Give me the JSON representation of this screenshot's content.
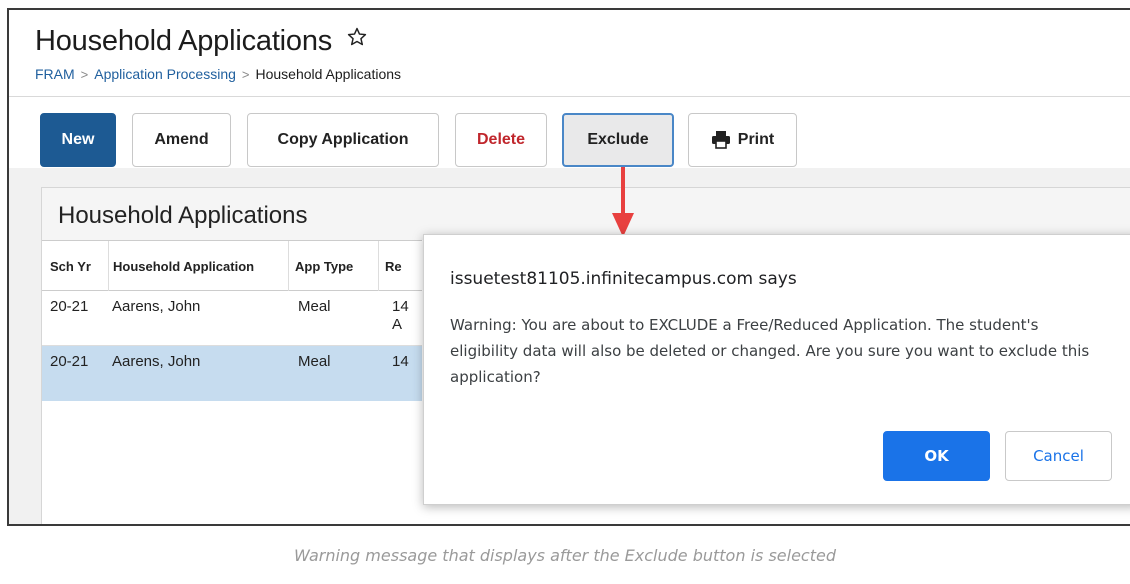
{
  "header": {
    "title": "Household Applications",
    "star_icon": "star-outline-icon",
    "breadcrumb": [
      "FRAM",
      "Application Processing",
      "Household Applications"
    ],
    "breadcrumb_separator": ">"
  },
  "toolbar": {
    "new_label": "New",
    "amend_label": "Amend",
    "copy_label": "Copy Application",
    "delete_label": "Delete",
    "exclude_label": "Exclude",
    "print_label": "Print",
    "print_icon": "printer-icon"
  },
  "panel": {
    "title": "Household Applications",
    "columns": [
      "Sch Yr",
      "Household Application",
      "App Type",
      "Re"
    ],
    "rows": [
      {
        "sch_yr": "20-21",
        "household": "Aarens, John",
        "app_type": "Meal",
        "received": "14\nA"
      },
      {
        "sch_yr": "20-21",
        "household": "Aarens, John",
        "app_type": "Meal",
        "received": "14"
      }
    ]
  },
  "dialog": {
    "title": "issuetest81105.infinitecampus.com says",
    "message": "Warning: You are about to EXCLUDE a Free/Reduced Application. The student's eligibility data will also be deleted or changed. Are you sure you want to exclude this application?",
    "ok_label": "OK",
    "cancel_label": "Cancel"
  },
  "caption": "Warning message that displays after the Exclude button is selected",
  "colors": {
    "primary_button": "#1d5a93",
    "delete_text": "#c0262c",
    "arrow": "#e8403f",
    "dialog_ok": "#1a73e8",
    "selected_row": "#c6dcef"
  }
}
